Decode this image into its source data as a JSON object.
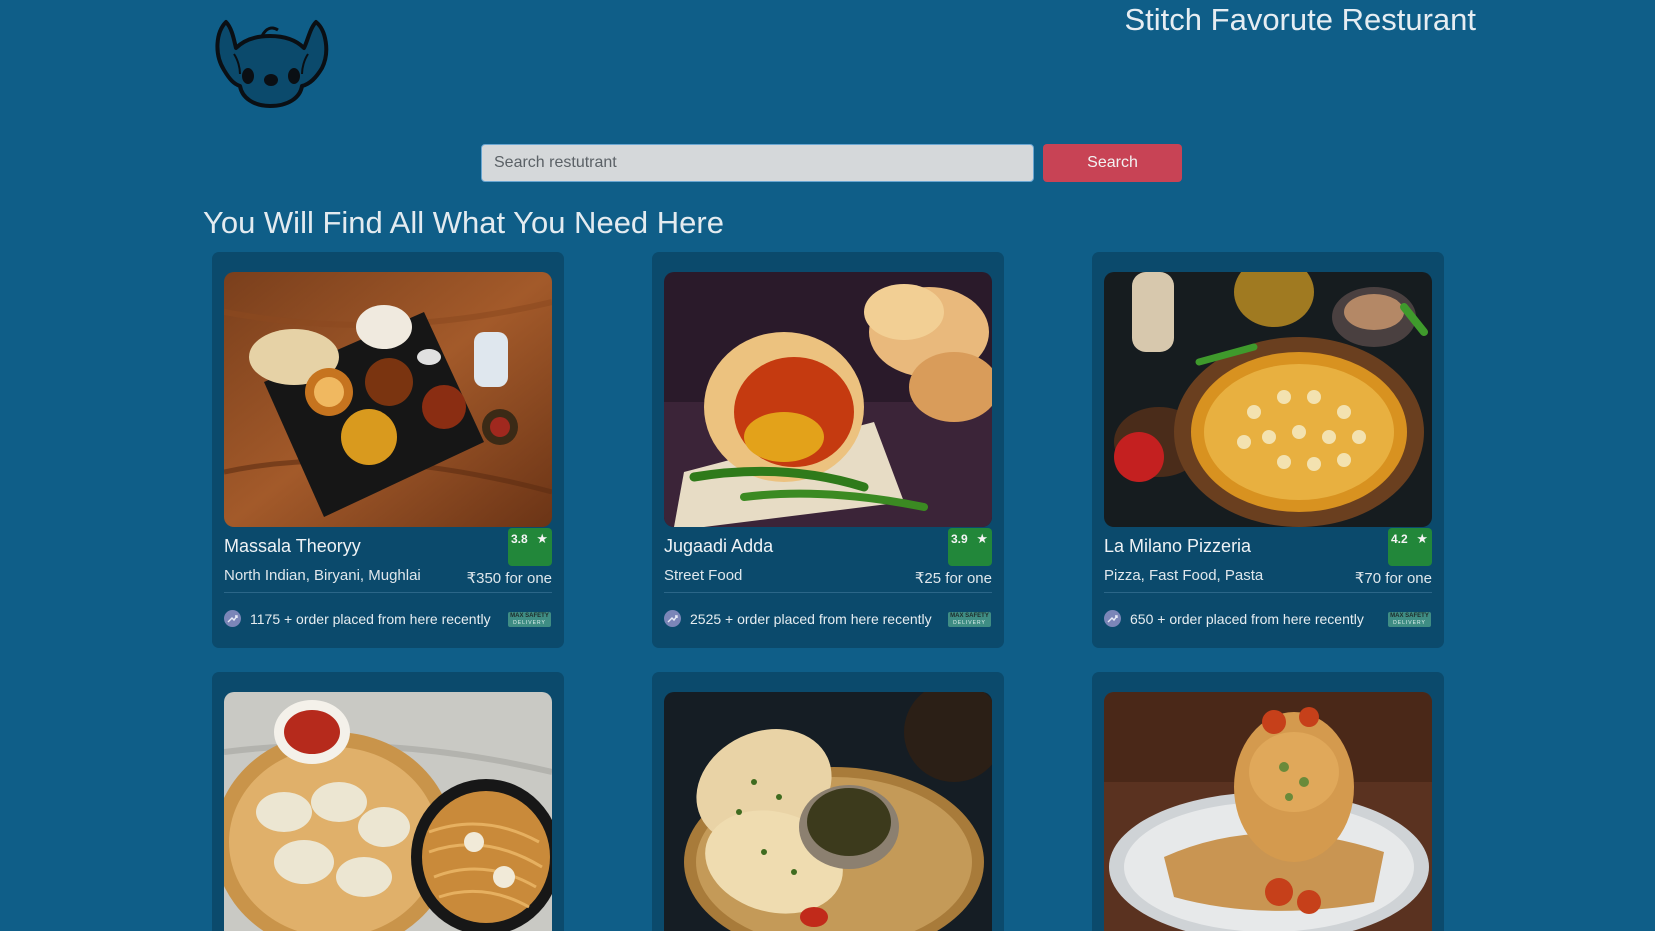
{
  "header": {
    "site_title": "Stitch Favorute Resturant",
    "logo_icon": "stitch-face-icon"
  },
  "search": {
    "placeholder": "Search restutrant",
    "value": "",
    "button_label": "Search"
  },
  "main": {
    "heading": "You Will Find All What You Need Here"
  },
  "colors": {
    "background": "#0f5e88",
    "card": "#0b4a6c",
    "search_button": "#c84355",
    "rating_badge": "#22873a"
  },
  "restaurants": [
    {
      "name": "Massala Theoryy",
      "rating": "3.8",
      "rating_icon": "star-icon",
      "cuisine": "North Indian, Biryani, Mughlai",
      "price": "₹350 for one",
      "orders": "1175 + order placed from here recently",
      "orders_icon": "trending-up-icon",
      "badge_icon": "max-safety-delivery-icon"
    },
    {
      "name": "Jugaadi Adda",
      "rating": "3.9",
      "rating_icon": "star-icon",
      "cuisine": "Street Food",
      "price": "₹25 for one",
      "orders": "2525 + order placed from here recently",
      "orders_icon": "trending-up-icon",
      "badge_icon": "max-safety-delivery-icon"
    },
    {
      "name": "La Milano Pizzeria",
      "rating": "4.2",
      "rating_icon": "star-icon",
      "cuisine": "Pizza, Fast Food, Pasta",
      "price": "₹70 for one",
      "orders": "650 + order placed from here recently",
      "orders_icon": "trending-up-icon",
      "badge_icon": "max-safety-delivery-icon"
    }
  ]
}
